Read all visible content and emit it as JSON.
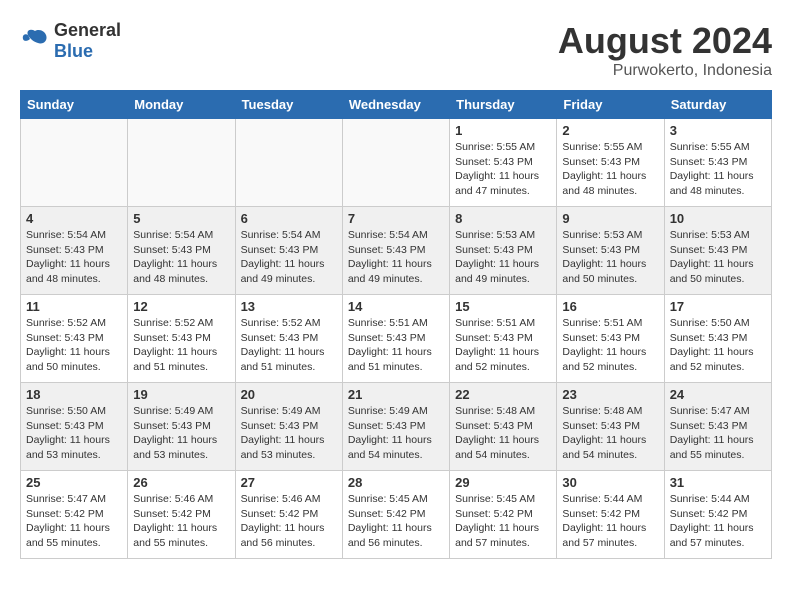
{
  "logo": {
    "text_general": "General",
    "text_blue": "Blue"
  },
  "title": {
    "month_year": "August 2024",
    "location": "Purwokerto, Indonesia"
  },
  "days_of_week": [
    "Sunday",
    "Monday",
    "Tuesday",
    "Wednesday",
    "Thursday",
    "Friday",
    "Saturday"
  ],
  "weeks": [
    [
      {
        "day": "",
        "empty": true
      },
      {
        "day": "",
        "empty": true
      },
      {
        "day": "",
        "empty": true
      },
      {
        "day": "",
        "empty": true
      },
      {
        "day": "1",
        "sunrise": "5:55 AM",
        "sunset": "5:43 PM",
        "daylight": "11 hours and 47 minutes."
      },
      {
        "day": "2",
        "sunrise": "5:55 AM",
        "sunset": "5:43 PM",
        "daylight": "11 hours and 48 minutes."
      },
      {
        "day": "3",
        "sunrise": "5:55 AM",
        "sunset": "5:43 PM",
        "daylight": "11 hours and 48 minutes."
      }
    ],
    [
      {
        "day": "4",
        "sunrise": "5:54 AM",
        "sunset": "5:43 PM",
        "daylight": "11 hours and 48 minutes."
      },
      {
        "day": "5",
        "sunrise": "5:54 AM",
        "sunset": "5:43 PM",
        "daylight": "11 hours and 48 minutes."
      },
      {
        "day": "6",
        "sunrise": "5:54 AM",
        "sunset": "5:43 PM",
        "daylight": "11 hours and 49 minutes."
      },
      {
        "day": "7",
        "sunrise": "5:54 AM",
        "sunset": "5:43 PM",
        "daylight": "11 hours and 49 minutes."
      },
      {
        "day": "8",
        "sunrise": "5:53 AM",
        "sunset": "5:43 PM",
        "daylight": "11 hours and 49 minutes."
      },
      {
        "day": "9",
        "sunrise": "5:53 AM",
        "sunset": "5:43 PM",
        "daylight": "11 hours and 50 minutes."
      },
      {
        "day": "10",
        "sunrise": "5:53 AM",
        "sunset": "5:43 PM",
        "daylight": "11 hours and 50 minutes."
      }
    ],
    [
      {
        "day": "11",
        "sunrise": "5:52 AM",
        "sunset": "5:43 PM",
        "daylight": "11 hours and 50 minutes."
      },
      {
        "day": "12",
        "sunrise": "5:52 AM",
        "sunset": "5:43 PM",
        "daylight": "11 hours and 51 minutes."
      },
      {
        "day": "13",
        "sunrise": "5:52 AM",
        "sunset": "5:43 PM",
        "daylight": "11 hours and 51 minutes."
      },
      {
        "day": "14",
        "sunrise": "5:51 AM",
        "sunset": "5:43 PM",
        "daylight": "11 hours and 51 minutes."
      },
      {
        "day": "15",
        "sunrise": "5:51 AM",
        "sunset": "5:43 PM",
        "daylight": "11 hours and 52 minutes."
      },
      {
        "day": "16",
        "sunrise": "5:51 AM",
        "sunset": "5:43 PM",
        "daylight": "11 hours and 52 minutes."
      },
      {
        "day": "17",
        "sunrise": "5:50 AM",
        "sunset": "5:43 PM",
        "daylight": "11 hours and 52 minutes."
      }
    ],
    [
      {
        "day": "18",
        "sunrise": "5:50 AM",
        "sunset": "5:43 PM",
        "daylight": "11 hours and 53 minutes."
      },
      {
        "day": "19",
        "sunrise": "5:49 AM",
        "sunset": "5:43 PM",
        "daylight": "11 hours and 53 minutes."
      },
      {
        "day": "20",
        "sunrise": "5:49 AM",
        "sunset": "5:43 PM",
        "daylight": "11 hours and 53 minutes."
      },
      {
        "day": "21",
        "sunrise": "5:49 AM",
        "sunset": "5:43 PM",
        "daylight": "11 hours and 54 minutes."
      },
      {
        "day": "22",
        "sunrise": "5:48 AM",
        "sunset": "5:43 PM",
        "daylight": "11 hours and 54 minutes."
      },
      {
        "day": "23",
        "sunrise": "5:48 AM",
        "sunset": "5:43 PM",
        "daylight": "11 hours and 54 minutes."
      },
      {
        "day": "24",
        "sunrise": "5:47 AM",
        "sunset": "5:43 PM",
        "daylight": "11 hours and 55 minutes."
      }
    ],
    [
      {
        "day": "25",
        "sunrise": "5:47 AM",
        "sunset": "5:42 PM",
        "daylight": "11 hours and 55 minutes."
      },
      {
        "day": "26",
        "sunrise": "5:46 AM",
        "sunset": "5:42 PM",
        "daylight": "11 hours and 55 minutes."
      },
      {
        "day": "27",
        "sunrise": "5:46 AM",
        "sunset": "5:42 PM",
        "daylight": "11 hours and 56 minutes."
      },
      {
        "day": "28",
        "sunrise": "5:45 AM",
        "sunset": "5:42 PM",
        "daylight": "11 hours and 56 minutes."
      },
      {
        "day": "29",
        "sunrise": "5:45 AM",
        "sunset": "5:42 PM",
        "daylight": "11 hours and 57 minutes."
      },
      {
        "day": "30",
        "sunrise": "5:44 AM",
        "sunset": "5:42 PM",
        "daylight": "11 hours and 57 minutes."
      },
      {
        "day": "31",
        "sunrise": "5:44 AM",
        "sunset": "5:42 PM",
        "daylight": "11 hours and 57 minutes."
      }
    ]
  ],
  "labels": {
    "sunrise": "Sunrise:",
    "sunset": "Sunset:",
    "daylight": "Daylight:"
  }
}
